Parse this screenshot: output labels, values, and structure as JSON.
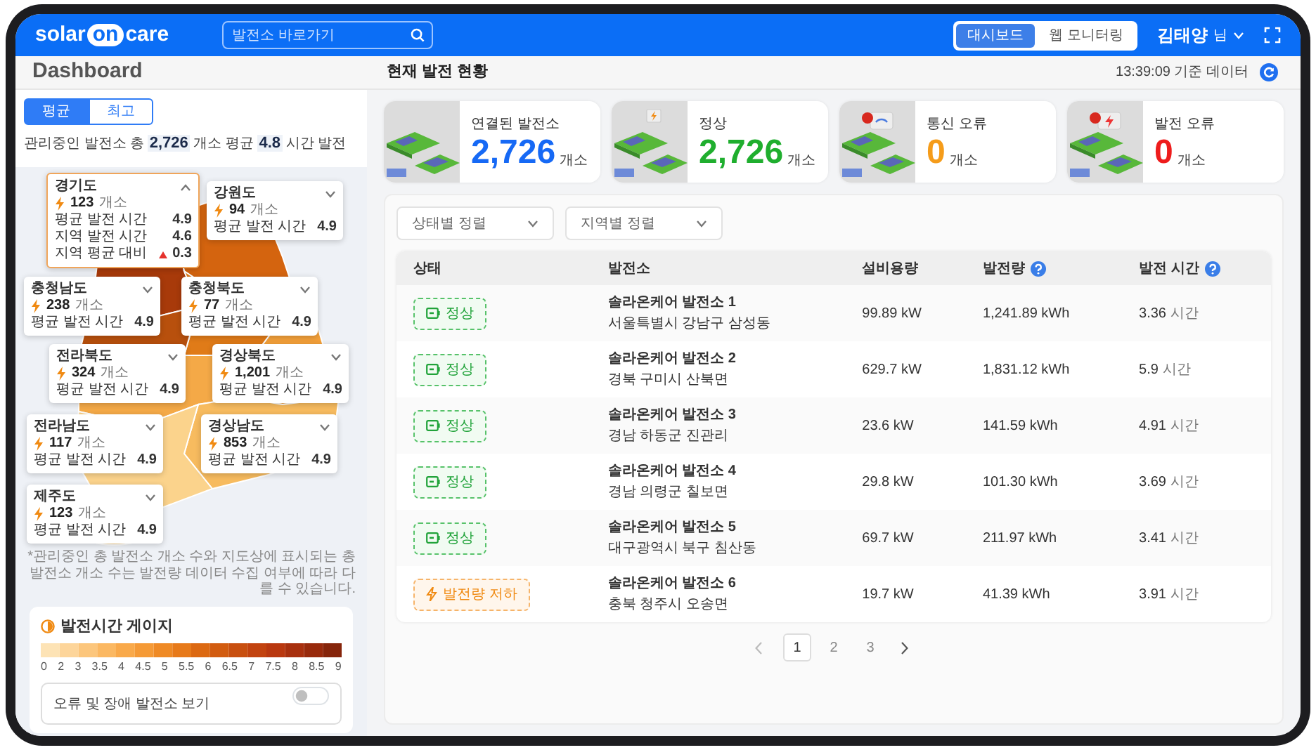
{
  "logo": {
    "prefix": "solar",
    "badge": "on",
    "suffix": "care"
  },
  "search": {
    "placeholder": "발전소 바로가기"
  },
  "view_switch": [
    {
      "label": "대시보드",
      "selected": true
    },
    {
      "label": "웹 모니터링",
      "selected": false
    }
  ],
  "user": {
    "name": "김태양",
    "suffix": "님"
  },
  "page_title": "Dashboard",
  "section_title": "현재 발전 현황",
  "updated": "13:39:09 기준 데이터",
  "sidebar": {
    "mode_tabs": [
      {
        "label": "평균",
        "selected": true
      },
      {
        "label": "최고",
        "selected": false
      }
    ],
    "summary": "관리중인 발전소 총 **2,726** 개소 평균 **4.8** 시간 발전",
    "regions": [
      {
        "name": "경기도",
        "expanded": true,
        "count": "123",
        "unit": "개소",
        "stats": [
          {
            "label": "평균 발전 시간",
            "value": "4.9",
            "up": false
          },
          {
            "label": "지역 발전 시간",
            "value": "4.6",
            "up": false
          },
          {
            "label": "지역 평균 대비",
            "value": "0.3",
            "up": true
          }
        ]
      },
      {
        "name": "강원도",
        "expanded": false,
        "count": "94",
        "unit": "개소",
        "stats": [
          {
            "label": "평균 발전 시간",
            "value": "4.9",
            "up": false
          }
        ]
      },
      {
        "name": "충청남도",
        "expanded": false,
        "count": "238",
        "unit": "개소",
        "stats": [
          {
            "label": "평균 발전 시간",
            "value": "4.9",
            "up": false
          }
        ]
      },
      {
        "name": "충청북도",
        "expanded": false,
        "count": "77",
        "unit": "개소",
        "stats": [
          {
            "label": "평균 발전 시간",
            "value": "4.9",
            "up": false
          }
        ]
      },
      {
        "name": "전라북도",
        "expanded": false,
        "count": "324",
        "unit": "개소",
        "stats": [
          {
            "label": "평균 발전 시간",
            "value": "4.9",
            "up": false
          }
        ]
      },
      {
        "name": "경상북도",
        "expanded": false,
        "count": "1,201",
        "unit": "개소",
        "stats": [
          {
            "label": "평균 발전 시간",
            "value": "4.9",
            "up": false
          }
        ]
      },
      {
        "name": "전라남도",
        "expanded": false,
        "count": "117",
        "unit": "개소",
        "stats": [
          {
            "label": "평균 발전 시간",
            "value": "4.9",
            "up": false
          }
        ]
      },
      {
        "name": "경상남도",
        "expanded": false,
        "count": "853",
        "unit": "개소",
        "stats": [
          {
            "label": "평균 발전 시간",
            "value": "4.9",
            "up": false
          }
        ]
      },
      {
        "name": "제주도",
        "expanded": false,
        "count": "123",
        "unit": "개소",
        "stats": [
          {
            "label": "평균 발전 시간",
            "value": "4.9",
            "up": false
          }
        ]
      }
    ],
    "note": "*관리중인 총 발전소 개소 수와 지도상에 표시되는 총 발전소 개소 수는 발전량 데이터 수집 여부에 따라 다를 수 있습니다.",
    "gauge": {
      "title": "발전시간 게이지",
      "ticks": [
        "0",
        "2",
        "3",
        "3.5",
        "4",
        "4.5",
        "5",
        "5.5",
        "6",
        "6.5",
        "7",
        "7.5",
        "8",
        "8.5",
        "9"
      ],
      "toggle": {
        "label": "오류 및 장애 발전소 보기",
        "on": false
      }
    }
  },
  "kpis": [
    {
      "kind": "connected",
      "label": "연결된 발전소",
      "value": "2,726",
      "unit": "개소"
    },
    {
      "kind": "normal",
      "label": "정상",
      "value": "2,726",
      "unit": "개소"
    },
    {
      "kind": "comm_error",
      "label": "통신 오류",
      "value": "0",
      "unit": "개소"
    },
    {
      "kind": "gen_error",
      "label": "발전 오류",
      "value": "0",
      "unit": "개소"
    }
  ],
  "filters": [
    "상태별 정렬",
    "지역별 정렬"
  ],
  "table": {
    "columns": [
      {
        "label": "상태",
        "help": false
      },
      {
        "label": "발전소",
        "help": false
      },
      {
        "label": "설비용량",
        "help": false
      },
      {
        "label": "발전량",
        "help": true
      },
      {
        "label": "발전 시간",
        "help": true
      }
    ],
    "rows": [
      {
        "status": {
          "kind": "normal",
          "label": "정상"
        },
        "name": "솔라온케어 발전소 1",
        "address": "서울특별시 강남구 삼성동",
        "capacity": "99.89 kW",
        "generation": "1,241.89 kWh",
        "hours": "3.36",
        "hours_unit": "시간"
      },
      {
        "status": {
          "kind": "normal",
          "label": "정상"
        },
        "name": "솔라온케어 발전소 2",
        "address": "경북 구미시 산북면",
        "capacity": "629.7 kW",
        "generation": "1,831.12 kWh",
        "hours": "5.9",
        "hours_unit": "시간"
      },
      {
        "status": {
          "kind": "normal",
          "label": "정상"
        },
        "name": "솔라온케어 발전소 3",
        "address": "경남 하동군 진관리",
        "capacity": "23.6 kW",
        "generation": "141.59 kWh",
        "hours": "4.91",
        "hours_unit": "시간"
      },
      {
        "status": {
          "kind": "normal",
          "label": "정상"
        },
        "name": "솔라온케어 발전소 4",
        "address": "경남 의령군 칠보면",
        "capacity": "29.8 kW",
        "generation": "101.30 kWh",
        "hours": "3.69",
        "hours_unit": "시간"
      },
      {
        "status": {
          "kind": "normal",
          "label": "정상"
        },
        "name": "솔라온케어 발전소 5",
        "address": "대구광역시 북구 침산동",
        "capacity": "69.7 kW",
        "generation": "211.97 kWh",
        "hours": "3.41",
        "hours_unit": "시간"
      },
      {
        "status": {
          "kind": "low",
          "label": "발전량 저하"
        },
        "name": "솔라온케어 발전소 6",
        "address": "충북 청주시 오송면",
        "capacity": "19.7 kW",
        "generation": "41.39 kWh",
        "hours": "3.91",
        "hours_unit": "시간"
      }
    ]
  },
  "pagination": [
    {
      "label": "1",
      "selected": true
    },
    {
      "label": "2",
      "selected": false
    },
    {
      "label": "3",
      "selected": false
    }
  ]
}
